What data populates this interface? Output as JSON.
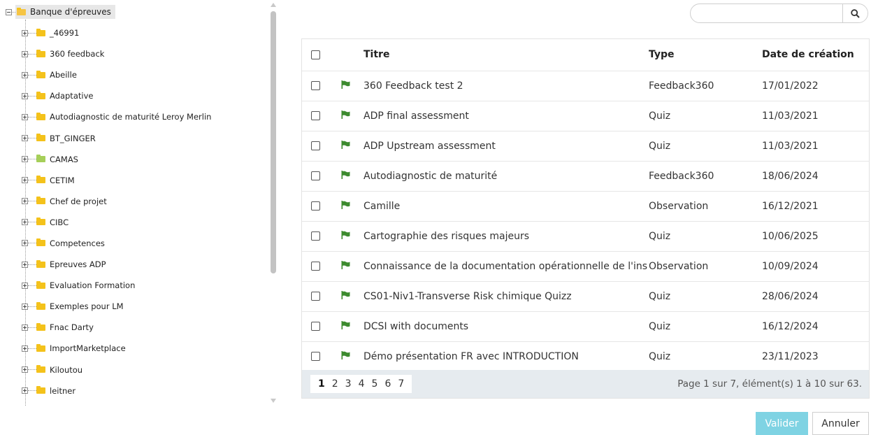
{
  "tree": {
    "root_label": "Banque d'épreuves",
    "items": [
      {
        "label": "_46991",
        "icon": "folder-icon"
      },
      {
        "label": "360 feedback",
        "icon": "folder-icon"
      },
      {
        "label": "Abeille",
        "icon": "folder-icon"
      },
      {
        "label": "Adaptative",
        "icon": "folder-icon"
      },
      {
        "label": "Autodiagnostic de maturité Leroy Merlin",
        "icon": "folder-icon"
      },
      {
        "label": "BT_GINGER",
        "icon": "folder-icon"
      },
      {
        "label": "CAMAS",
        "icon": "folder-icon-green"
      },
      {
        "label": "CETIM",
        "icon": "folder-icon"
      },
      {
        "label": "Chef de projet",
        "icon": "folder-icon"
      },
      {
        "label": "CIBC",
        "icon": "folder-icon"
      },
      {
        "label": "Competences",
        "icon": "folder-icon"
      },
      {
        "label": "Epreuves ADP",
        "icon": "folder-icon"
      },
      {
        "label": "Evaluation Formation",
        "icon": "folder-icon"
      },
      {
        "label": "Exemples pour LM",
        "icon": "folder-icon"
      },
      {
        "label": "Fnac Darty",
        "icon": "folder-icon"
      },
      {
        "label": "ImportMarketplace",
        "icon": "folder-icon"
      },
      {
        "label": "Kiloutou",
        "icon": "folder-icon"
      },
      {
        "label": "leitner",
        "icon": "folder-icon"
      }
    ]
  },
  "search": {
    "value": "",
    "placeholder": "",
    "icon": "search-icon"
  },
  "table": {
    "headers": {
      "title": "Titre",
      "type": "Type",
      "date": "Date de création"
    },
    "rows": [
      {
        "title": "360 Feedback test 2",
        "type": "Feedback360",
        "date": "17/01/2022"
      },
      {
        "title": "ADP final assessment",
        "type": "Quiz",
        "date": "11/03/2021"
      },
      {
        "title": "ADP Upstream assessment",
        "type": "Quiz",
        "date": "11/03/2021"
      },
      {
        "title": "Autodiagnostic de maturité",
        "type": "Feedback360",
        "date": "18/06/2024"
      },
      {
        "title": "Camille",
        "type": "Observation",
        "date": "16/12/2021"
      },
      {
        "title": "Cartographie des risques majeurs",
        "type": "Quiz",
        "date": "10/06/2025"
      },
      {
        "title": "Connaissance de la documentation opérationnelle de l'ins",
        "type": "Observation",
        "date": "10/09/2024"
      },
      {
        "title": "CS01-Niv1-Transverse Risk chimique Quizz",
        "type": "Quiz",
        "date": "28/06/2024"
      },
      {
        "title": "DCSI with documents",
        "type": "Quiz",
        "date": "16/12/2024"
      },
      {
        "title": "Démo présentation FR avec INTRODUCTION",
        "type": "Quiz",
        "date": "23/11/2023"
      }
    ]
  },
  "pager": {
    "pages": [
      "1",
      "2",
      "3",
      "4",
      "5",
      "6",
      "7"
    ],
    "current_page": "1",
    "info": "Page 1 sur 7, élément(s) 1 à 10 sur 63."
  },
  "buttons": {
    "validate": "Valider",
    "cancel": "Annuler"
  },
  "colors": {
    "folder": "#f4c21b",
    "folder_green": "#a6cf59",
    "flag": "#3d8b2f",
    "validate_button": "#7fd3e3",
    "pager_bg": "#e6ebef"
  }
}
